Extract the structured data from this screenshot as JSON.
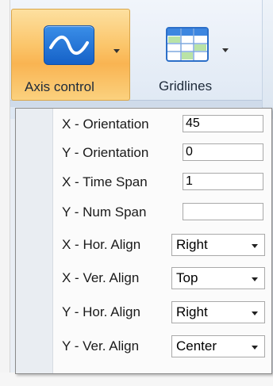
{
  "ribbon": {
    "axis_control_label": "Axis control",
    "gridlines_label": "Gridlines",
    "axis_icon": "axis-wave-icon",
    "gridlines_icon": "grid-table-icon",
    "accent_color": "#f9b452",
    "icon_blue": "#1561c7"
  },
  "panel": {
    "rows": [
      {
        "label": "X - Orientation",
        "type": "text",
        "value": "45"
      },
      {
        "label": "Y - Orientation",
        "type": "text",
        "value": "0"
      },
      {
        "label": "X - Time Span",
        "type": "text",
        "value": "1"
      },
      {
        "label": "Y - Num Span",
        "type": "text",
        "value": ""
      },
      {
        "label": "X - Hor. Align",
        "type": "select",
        "value": "Right"
      },
      {
        "label": "X - Ver. Align",
        "type": "select",
        "value": "Top"
      },
      {
        "label": "Y - Hor. Align",
        "type": "select",
        "value": "Right"
      },
      {
        "label": "Y - Ver. Align",
        "type": "select",
        "value": "Center"
      }
    ]
  }
}
